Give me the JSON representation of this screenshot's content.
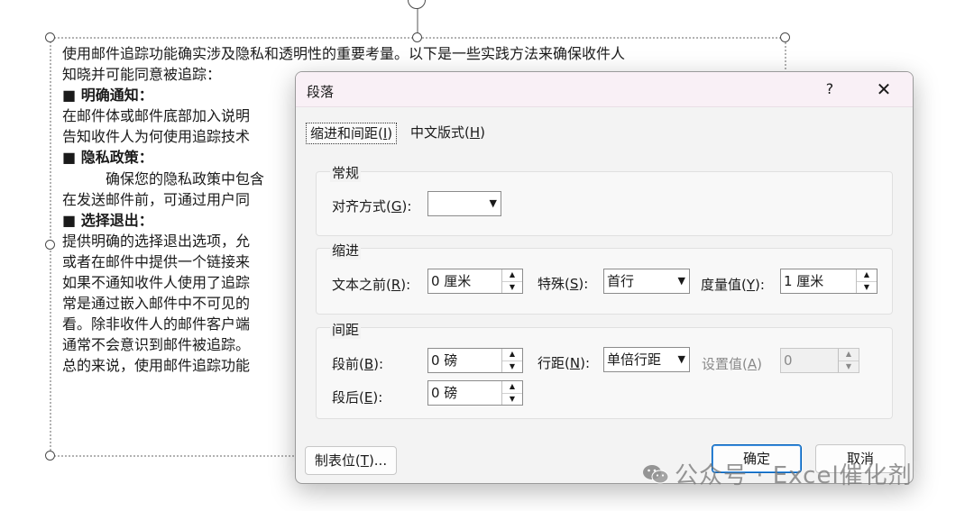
{
  "document": {
    "lines": [
      "使用邮件追踪功能确实涉及隐私和透明性的重要考量。以下是一些实践方法来确保收件人",
      "知晓并可能同意被追踪：",
      "■ 明确通知：",
      "在邮件体或邮件底部加入说明",
      "告知收件人为何使用追踪技术",
      "■ 隐私政策：",
      "确保您的隐私政策中包含",
      "在发送邮件前，可通过用户同",
      "■ 选择退出：",
      "提供明确的选择退出选项，允",
      "或者在邮件中提供一个链接来",
      "如果不通知收件人使用了追踪",
      "常是通过嵌入邮件中不可见的",
      "看。除非收件人的邮件客户端",
      "通常不会意识到邮件被追踪。",
      "总的来说，使用邮件追踪功能"
    ]
  },
  "dialog": {
    "title": "段落",
    "help": "?",
    "close": "✕",
    "tabs": [
      {
        "label": "缩进和间距(",
        "key": "I",
        "suffix": ")"
      },
      {
        "label": "中文版式(",
        "key": "H",
        "suffix": ")"
      }
    ],
    "general": {
      "title": "常规",
      "alignment_label": "对齐方式(",
      "alignment_key": "G",
      "alignment_suffix": "):",
      "alignment_value": ""
    },
    "indent": {
      "title": "缩进",
      "before_label": "文本之前(",
      "before_key": "R",
      "before_suffix": "):",
      "before_value": "0 厘米",
      "special_label": "特殊(",
      "special_key": "S",
      "special_suffix": "):",
      "special_value": "首行",
      "measure_label": "度量值(",
      "measure_key": "Y",
      "measure_suffix": "):",
      "measure_value": "1 厘米"
    },
    "spacing": {
      "title": "间距",
      "before_label": "段前(",
      "before_key": "B",
      "before_suffix": "):",
      "before_value": "0 磅",
      "after_label": "段后(",
      "after_key": "E",
      "after_suffix": "):",
      "after_value": "0 磅",
      "line_label": "行距(",
      "line_key": "N",
      "line_suffix": "):",
      "line_value": "单倍行距",
      "setting_label": "设置值(",
      "setting_key": "A",
      "setting_suffix": ")",
      "setting_value": "0"
    },
    "buttons": {
      "tabs_label": "制表位(",
      "tabs_key": "T",
      "tabs_suffix": ")...",
      "ok": "确定",
      "cancel": "取消"
    }
  },
  "watermark": {
    "text": "公众号 · Excel催化剂"
  },
  "colors": {
    "titlebar": "#f9f0f6",
    "primary_border": "#005fb8",
    "watermark": "#787878"
  }
}
